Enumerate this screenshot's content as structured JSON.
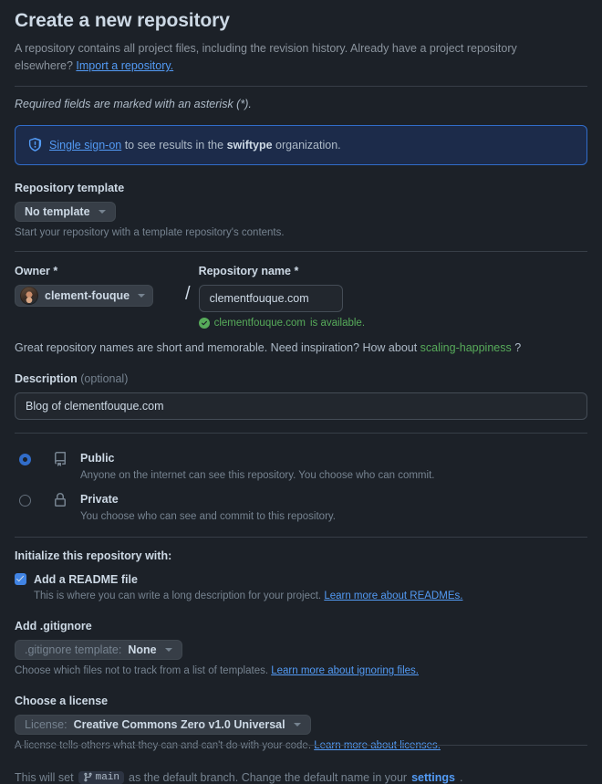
{
  "header": {
    "title": "Create a new repository",
    "description_part1": "A repository contains all project files, including the revision history. Already have a project repository elsewhere? ",
    "import_link": "Import a repository.",
    "required_note": "Required fields are marked with an asterisk (*)."
  },
  "sso_banner": {
    "icon": "shield-icon",
    "link_text": "Single sign-on",
    "text_mid": " to see results in the ",
    "org": "swiftype",
    "text_end": " organization.",
    "border_color": "#316dca",
    "background_color": "#1c2b4a"
  },
  "repository_template": {
    "label": "Repository template",
    "selected": "No template",
    "hint": "Start your repository with a template repository's contents."
  },
  "owner": {
    "label": "Owner *",
    "value": "clement-fouque",
    "avatar": "user-avatar",
    "separator": "/"
  },
  "repository_name": {
    "label": "Repository name *",
    "value": "clementfouque.com",
    "availability_icon": "check-circle-icon",
    "availability_name": "clementfouque.com",
    "availability_text": " is available.",
    "availability_color": "#57ab5a"
  },
  "suggestion": {
    "text_before": "Great repository names are short and memorable. Need inspiration? How about ",
    "name": "scaling-happiness",
    "text_after": " ?"
  },
  "description": {
    "label": "Description",
    "optional": "(optional)",
    "value": "Blog of clementfouque.com"
  },
  "visibility": {
    "options": [
      {
        "id": "public",
        "icon": "repo-icon",
        "title": "Public",
        "subtitle": "Anyone on the internet can see this repository. You choose who can commit.",
        "selected": true
      },
      {
        "id": "private",
        "icon": "lock-icon",
        "title": "Private",
        "subtitle": "You choose who can see and commit to this repository.",
        "selected": false
      }
    ],
    "selected_color": "#316dca"
  },
  "initialize": {
    "title": "Initialize this repository with:",
    "readme": {
      "label": "Add a README file",
      "checked": true,
      "hint_text": "This is where you can write a long description for your project. ",
      "hint_link": "Learn more about READMEs."
    }
  },
  "gitignore": {
    "label": "Add .gitignore",
    "select_prefix": ".gitignore template:",
    "select_value": "None",
    "hint_text": "Choose which files not to track from a list of templates. ",
    "hint_link": "Learn more about ignoring files."
  },
  "license": {
    "label": "Choose a license",
    "select_prefix": "License:",
    "select_value": "Creative Commons Zero v1.0 Universal",
    "hint_text": "A license tells others what they can and can't do with your code. ",
    "hint_link": "Learn more about licenses."
  },
  "default_branch": {
    "text_before": "This will set",
    "branch_icon": "git-branch-icon",
    "branch_name": "main",
    "text_mid": "as the default branch. Change the default name in your",
    "settings_link": "settings",
    "text_end": "."
  }
}
